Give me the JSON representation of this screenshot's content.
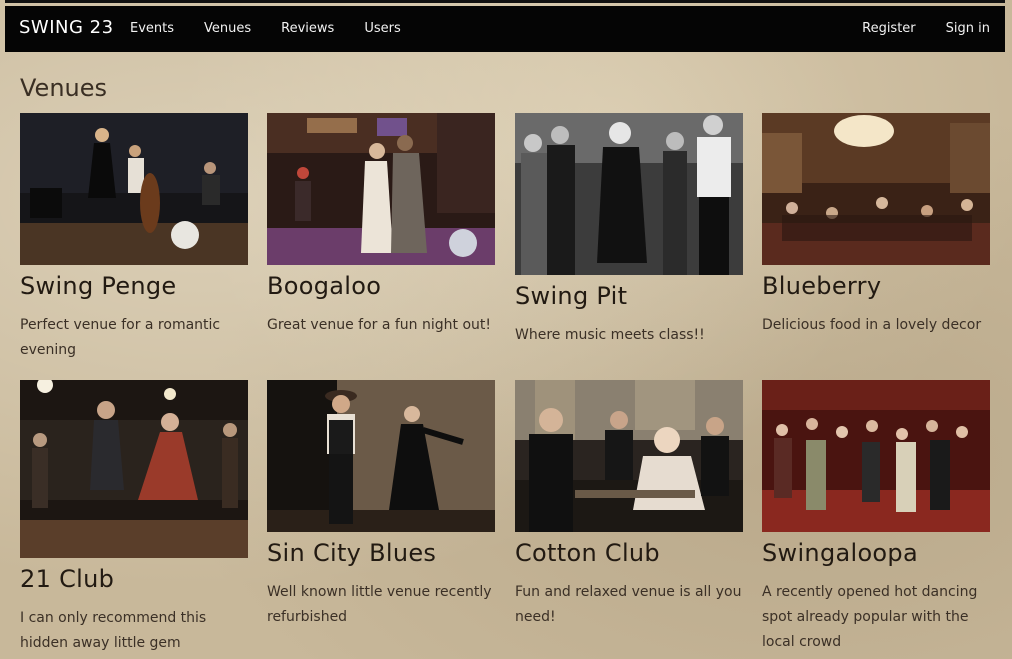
{
  "brand": "SWING 23",
  "nav": {
    "left": [
      "Events",
      "Venues",
      "Reviews",
      "Users"
    ],
    "right": [
      "Register",
      "Sign in"
    ]
  },
  "page": {
    "title": "Venues"
  },
  "venues": [
    {
      "name": "Swing Penge",
      "description": "Perfect venue for a romantic evening",
      "photo": "jazz-band-photo"
    },
    {
      "name": "Boogaloo",
      "description": "Great venue for a fun night out!",
      "photo": "couple-dancing-photo"
    },
    {
      "name": "Swing Pit",
      "description": "Where music meets class!!",
      "photo": "flapper-crowd-photo"
    },
    {
      "name": "Blueberry",
      "description": "Delicious food in a lovely decor",
      "photo": "ballroom-photo"
    },
    {
      "name": "21 Club",
      "description": "I can only recommend this hidden away little gem",
      "photo": "lindy-hop-photo"
    },
    {
      "name": "Sin City Blues",
      "description": "Well known little venue recently refurbished",
      "photo": "speakeasy-dance-photo"
    },
    {
      "name": "Cotton Club",
      "description": "Fun and relaxed venue is all you need!",
      "photo": "gatsby-table-photo"
    },
    {
      "name": "Swingaloopa",
      "description": "A recently opened hot dancing spot already popular with the local crowd",
      "photo": "dance-floor-crowd-photo"
    }
  ],
  "colors": {
    "navbar": "#050505",
    "page_background": "#c8b89a",
    "text": "#221a12"
  }
}
